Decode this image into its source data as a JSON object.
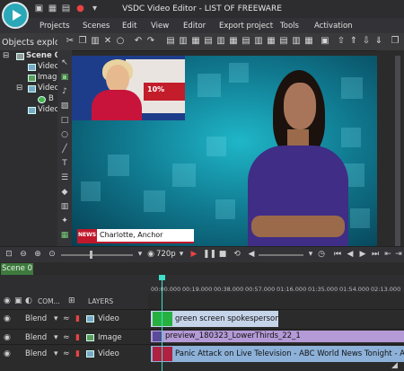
{
  "app": {
    "title": "VSDC Video Editor - LIST OF FREEWARE"
  },
  "menu": [
    "Projects",
    "Scenes",
    "Edit",
    "View",
    "Editor",
    "Export project",
    "Tools",
    "Activation"
  ],
  "objects_explorer": {
    "title": "Objects explo",
    "tree": [
      "Scene 0",
      "Video",
      "Image",
      "Video",
      "B",
      "Video"
    ]
  },
  "preview": {
    "inset_number": "10%",
    "lower_third": {
      "badge": "NEWS",
      "text": "Charlotte, Anchor"
    }
  },
  "playback": {
    "resolution": "720p"
  },
  "scene_tab": "Scene 0",
  "timeline": {
    "header": {
      "composition": "COM...",
      "layers": "LAYERS"
    },
    "ticks": [
      "00:00.000",
      "00:19.000",
      "00:38.000",
      "00:57.000",
      "01:16.000",
      "01:35.000",
      "01:54.000",
      "02:13.000"
    ],
    "tracks": [
      {
        "blend": "Blend",
        "type": "Video",
        "clip": "green screen spokesperson exa"
      },
      {
        "blend": "Blend",
        "type": "Image",
        "clip": "preview_180323_LowerThirds_22_1"
      },
      {
        "blend": "Blend",
        "type": "Video",
        "clip": "Panic Attack on Live Television - ABC World News Tonight - ABC News"
      }
    ]
  },
  "colors": {
    "scene_tab": "#3e7a3e",
    "playhead": "#3fe0c8",
    "clip_video": "#8db1d8",
    "clip_image": "#b49ad6",
    "clip_green": "#c6d4ea"
  }
}
